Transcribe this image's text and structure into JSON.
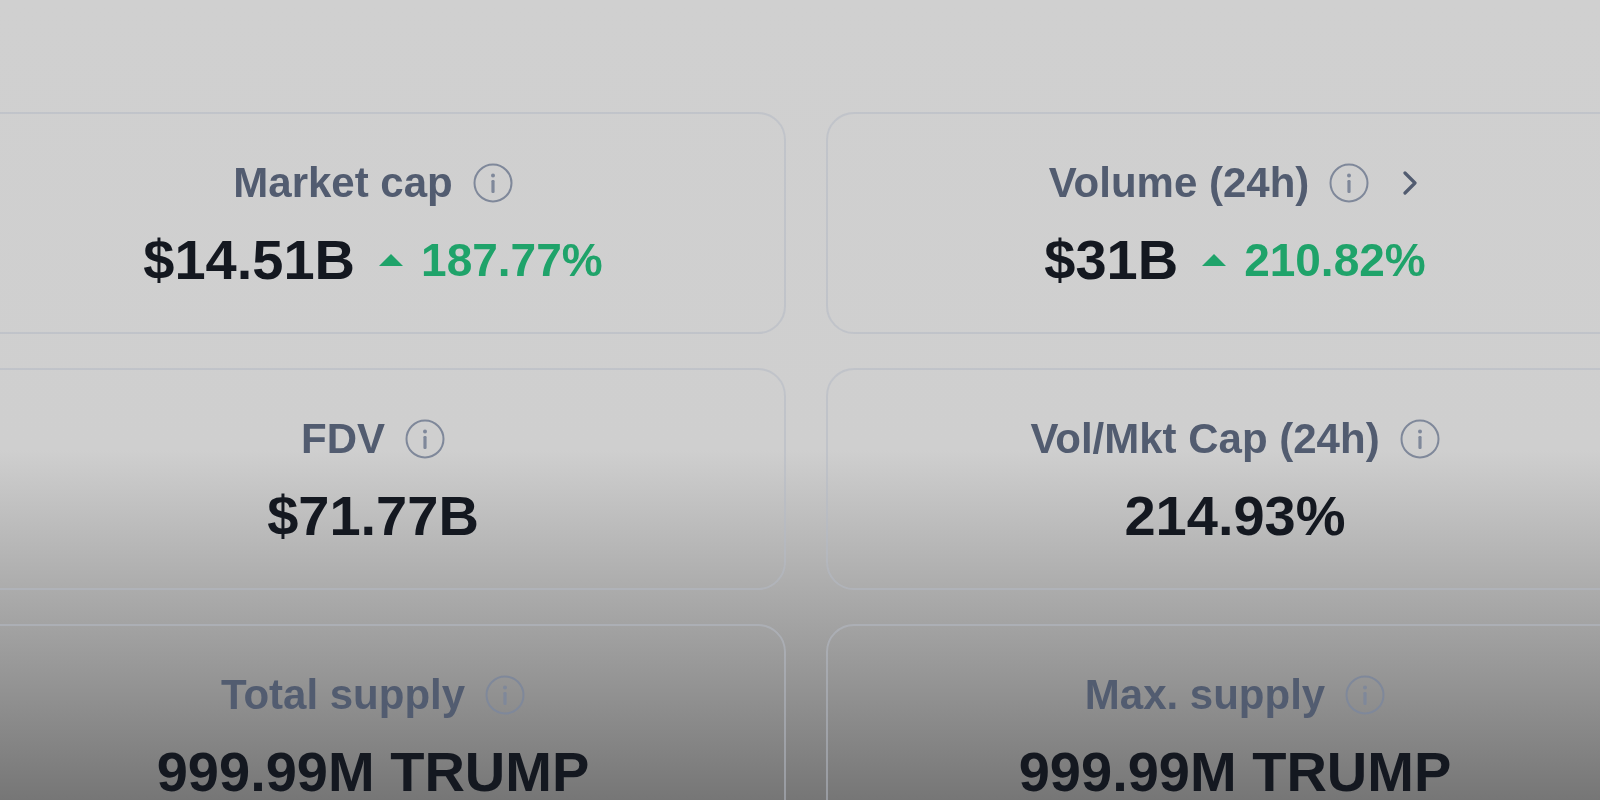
{
  "cards": [
    {
      "label": "Market cap",
      "link": false,
      "value": "$14.51B",
      "change": {
        "rising": true,
        "text": "187.77%"
      }
    },
    {
      "label": "Volume (24h)",
      "link": true,
      "value": "$31B",
      "change": {
        "rising": true,
        "text": "210.82%"
      }
    },
    {
      "label": "FDV",
      "link": false,
      "value": "$71.77B"
    },
    {
      "label": "Vol/Mkt Cap (24h)",
      "link": false,
      "value": "214.93%"
    },
    {
      "label": "Total supply",
      "link": false,
      "value": "999.99M TRUMP"
    },
    {
      "label": "Max. supply",
      "link": false,
      "value": "999.99M TRUMP"
    }
  ]
}
